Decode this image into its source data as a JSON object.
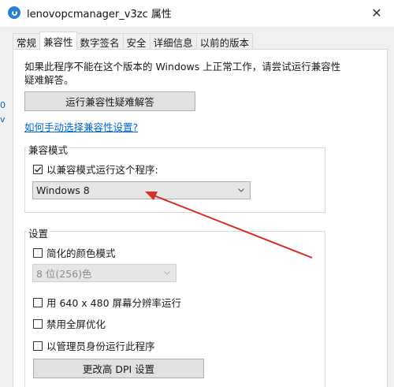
{
  "window": {
    "title": "lenovopcmanager_v3zc 属性",
    "close_glyph": "✕"
  },
  "tabs": [
    {
      "label": "常规",
      "active": false
    },
    {
      "label": "兼容性",
      "active": true
    },
    {
      "label": "数字签名",
      "active": false
    },
    {
      "label": "安全",
      "active": false
    },
    {
      "label": "详细信息",
      "active": false
    },
    {
      "label": "以前的版本",
      "active": false
    }
  ],
  "compat": {
    "description_line1": "如果此程序不能在这个版本的 Windows 上正常工作，请尝试运行兼容性",
    "description_line2": "疑难解答。",
    "troubleshoot_button": "运行兼容性疑难解答",
    "manual_link": "如何手动选择兼容性设置?",
    "mode_group_label": "兼容模式",
    "mode_checkbox_label": "以兼容模式运行这个程序:",
    "mode_checked": true,
    "mode_select_value": "Windows 8"
  },
  "settings": {
    "group_label": "设置",
    "reduced_color_label": "简化的颜色模式",
    "reduced_color_checked": false,
    "color_select_value": "8 位(256)色",
    "resolution_label": "用 640 x 480 屏幕分辨率运行",
    "resolution_checked": false,
    "fullscreen_label": "禁用全屏优化",
    "fullscreen_checked": false,
    "admin_label": "以管理员身份运行此程序",
    "admin_checked": false,
    "dpi_button": "更改高 DPI 设置"
  },
  "left_edge": {
    "mark1": "0",
    "mark2": "v"
  },
  "colors": {
    "accent_link": "#0066cc",
    "arrow": "#d32f2f"
  }
}
